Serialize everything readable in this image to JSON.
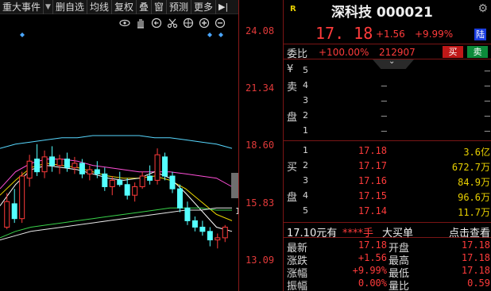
{
  "toolbar": {
    "items": [
      "重大事件",
      "删自选",
      "均线",
      "复权",
      "叠",
      "窗",
      "预测",
      "更多"
    ],
    "dropdown_glyph": "▼",
    "arrow_glyph": "▶|"
  },
  "chart_icons": [
    "eye-icon",
    "hand-icon",
    "undo-icon",
    "scissors-icon",
    "target-icon",
    "zoom-in-icon",
    "zoom-out-icon"
  ],
  "price_axis": {
    "labels": [
      "24.08",
      "21.34",
      "18.60",
      "15.83",
      "13.09"
    ]
  },
  "chart_data": {
    "type": "candlestick",
    "y_range": [
      12.0,
      25.0
    ],
    "last_price_marker": "15",
    "candles": [
      {
        "o": 15.0,
        "h": 16.6,
        "l": 14.9,
        "c": 16.2
      },
      {
        "o": 16.1,
        "h": 16.8,
        "l": 15.2,
        "c": 15.4
      },
      {
        "o": 15.4,
        "h": 17.6,
        "l": 15.2,
        "c": 17.4
      },
      {
        "o": 17.3,
        "h": 18.4,
        "l": 16.9,
        "c": 18.1
      },
      {
        "o": 18.2,
        "h": 18.9,
        "l": 17.4,
        "c": 17.6
      },
      {
        "o": 17.6,
        "h": 18.6,
        "l": 17.3,
        "c": 18.3
      },
      {
        "o": 18.3,
        "h": 18.8,
        "l": 17.6,
        "c": 17.9
      },
      {
        "o": 17.9,
        "h": 18.4,
        "l": 17.5,
        "c": 18.2
      },
      {
        "o": 18.2,
        "h": 18.5,
        "l": 17.6,
        "c": 17.8
      },
      {
        "o": 17.8,
        "h": 18.3,
        "l": 17.5,
        "c": 18.0
      },
      {
        "o": 18.0,
        "h": 18.2,
        "l": 17.3,
        "c": 17.5
      },
      {
        "o": 17.5,
        "h": 17.9,
        "l": 17.2,
        "c": 17.7
      },
      {
        "o": 17.7,
        "h": 18.1,
        "l": 17.3,
        "c": 17.5
      },
      {
        "o": 17.5,
        "h": 17.8,
        "l": 16.7,
        "c": 16.9
      },
      {
        "o": 16.9,
        "h": 17.4,
        "l": 16.5,
        "c": 17.2
      },
      {
        "o": 17.2,
        "h": 17.6,
        "l": 16.9,
        "c": 17.0
      },
      {
        "o": 17.0,
        "h": 17.3,
        "l": 16.3,
        "c": 16.5
      },
      {
        "o": 16.5,
        "h": 17.1,
        "l": 16.2,
        "c": 16.9
      },
      {
        "o": 16.9,
        "h": 17.6,
        "l": 16.8,
        "c": 17.4
      },
      {
        "o": 17.4,
        "h": 17.9,
        "l": 17.0,
        "c": 17.2
      },
      {
        "o": 17.2,
        "h": 18.7,
        "l": 17.0,
        "c": 18.4
      },
      {
        "o": 18.3,
        "h": 18.5,
        "l": 17.2,
        "c": 17.4
      },
      {
        "o": 17.4,
        "h": 17.6,
        "l": 16.6,
        "c": 16.8
      },
      {
        "o": 16.8,
        "h": 17.0,
        "l": 15.7,
        "c": 15.9
      },
      {
        "o": 15.9,
        "h": 16.2,
        "l": 15.1,
        "c": 15.3
      },
      {
        "o": 15.3,
        "h": 15.5,
        "l": 14.8,
        "c": 15.0
      },
      {
        "o": 15.0,
        "h": 15.3,
        "l": 14.6,
        "c": 14.8
      },
      {
        "o": 14.8,
        "h": 15.0,
        "l": 14.1,
        "c": 14.4
      },
      {
        "o": 14.4,
        "h": 14.7,
        "l": 14.0,
        "c": 14.5
      },
      {
        "o": 14.5,
        "h": 15.1,
        "l": 14.3,
        "c": 15.0
      }
    ],
    "ma_lines": [
      {
        "color": "#58d8ff",
        "values": [
          18.7,
          18.9,
          19.0,
          19.1,
          19.2,
          19.2,
          19.3,
          19.3,
          19.3,
          19.3,
          19.2,
          19.2,
          19.1,
          19.0,
          18.9,
          18.7
        ]
      },
      {
        "color": "#ff4fd8",
        "values": [
          16.8,
          17.6,
          18.0,
          18.2,
          18.2,
          18.1,
          17.9,
          17.8,
          17.7,
          17.6,
          17.6,
          17.6,
          17.5,
          17.4,
          17.3,
          16.9
        ]
      },
      {
        "color": "#e6d200",
        "values": [
          16.5,
          17.2,
          17.8,
          18.0,
          17.9,
          17.8,
          17.6,
          17.4,
          17.3,
          17.3,
          17.4,
          17.2,
          16.8,
          16.2,
          15.6,
          15.3
        ]
      },
      {
        "color": "#ffffff",
        "values": [
          16.0,
          17.0,
          17.7,
          17.9,
          17.8,
          17.7,
          17.5,
          17.3,
          17.2,
          17.3,
          17.6,
          17.3,
          16.6,
          15.8,
          15.0,
          14.8
        ]
      },
      {
        "color": "#39d24a",
        "values": [
          14.5,
          14.8,
          15.0,
          15.1,
          15.2,
          15.3,
          15.4,
          15.5,
          15.6,
          15.7,
          15.8,
          15.9,
          15.9,
          15.9,
          15.8,
          15.8
        ]
      },
      {
        "color": "#e8e8e8",
        "values": [
          14.4,
          14.6,
          14.8,
          14.9,
          15.0,
          15.1,
          15.2,
          15.3,
          15.4,
          15.5,
          15.6,
          15.7,
          15.8,
          15.8,
          15.9,
          15.9
        ]
      }
    ]
  },
  "panel": {
    "badge": "R",
    "title": "深科技 000021",
    "last_price": "17. 18",
    "change": "+1.56",
    "change_pct": "+9.99%",
    "market_badge": "陆",
    "weibi_label": "委比",
    "weibi_value": "+100.00%",
    "weicha_value": "212907",
    "buy_label": "买",
    "sell_label": "卖",
    "sell_side_chars": [
      "¥",
      "卖",
      "",
      "盘",
      ""
    ],
    "sell_levels": [
      "5",
      "4",
      "3",
      "2",
      "1"
    ],
    "sell_prices": [
      "",
      "–",
      "–",
      "–",
      "–"
    ],
    "sell_vols": [
      "–",
      "–",
      "–",
      "–",
      "–"
    ],
    "buy_side_chars": [
      "",
      "买",
      "",
      "盘",
      ""
    ],
    "buy_levels": [
      "1",
      "2",
      "3",
      "4",
      "5"
    ],
    "buy_prices": [
      "17.18",
      "17.17",
      "17.16",
      "17.15",
      "17.14"
    ],
    "buy_vols": [
      "3.6亿",
      "672.7万",
      "84.9万",
      "96.6万",
      "11.7万"
    ],
    "ticker": {
      "price": "17.10元有",
      "stars": "****手",
      "label": "大买单",
      "link": "点击查看"
    },
    "stats": [
      {
        "l1": "最新",
        "v1": "17.18",
        "l2": "开盘",
        "v2": "17.18"
      },
      {
        "l1": "涨跌",
        "v1": "+1.56",
        "l2": "最高",
        "v2": "17.18"
      },
      {
        "l1": "涨幅",
        "v1": "+9.99%",
        "l2": "最低",
        "v2": "17.18"
      },
      {
        "l1": "振幅",
        "v1": "0.00%",
        "l2": "量比",
        "v2": "0.59"
      }
    ]
  }
}
